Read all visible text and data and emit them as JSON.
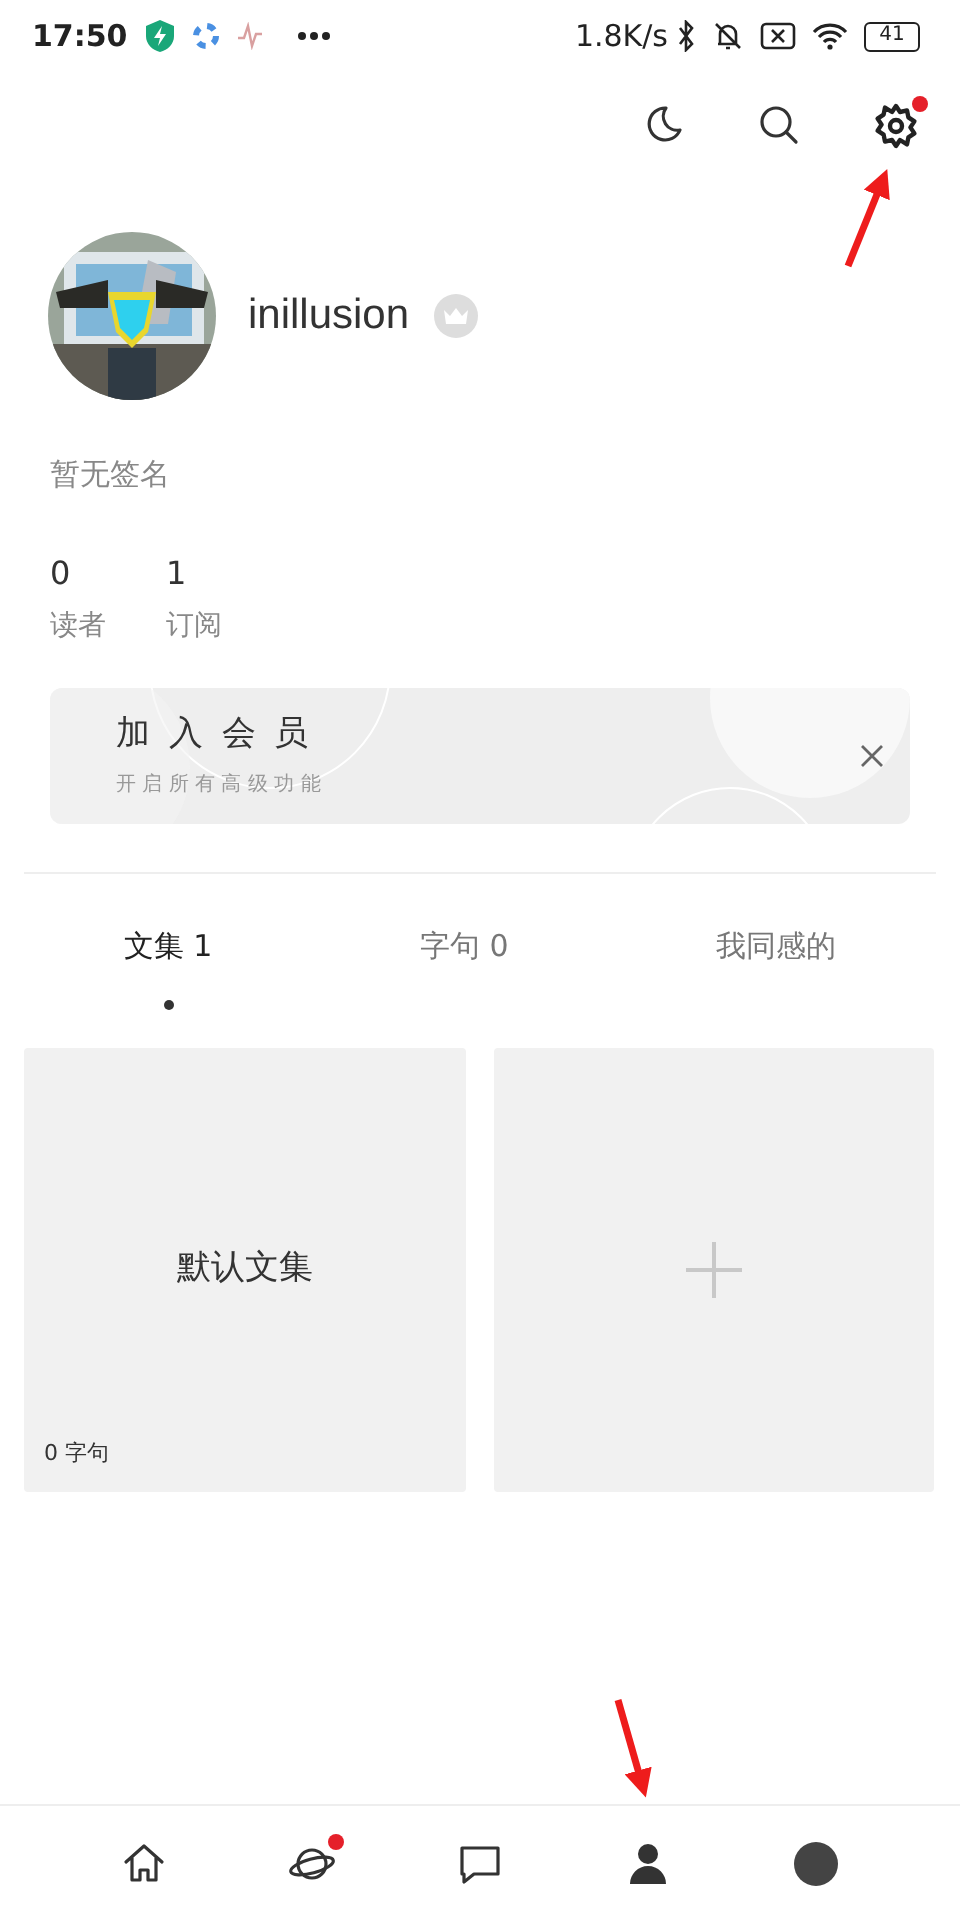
{
  "status_bar": {
    "time": "17:50",
    "net_speed": "1.8K/s",
    "battery": "41"
  },
  "top_actions": [
    {
      "kind": "night",
      "dot": false,
      "annotated": false
    },
    {
      "kind": "search",
      "dot": false,
      "annotated": false
    },
    {
      "kind": "settings",
      "dot": true,
      "annotated": true
    }
  ],
  "profile": {
    "username": "inillusion",
    "signature": "暂无签名",
    "stats": [
      {
        "value": "0",
        "label": "读者"
      },
      {
        "value": "1",
        "label": "订阅"
      }
    ]
  },
  "member_banner": {
    "title": "加 入 会 员",
    "subtitle": "开 启 所 有 高 级 功 能"
  },
  "tabs": [
    {
      "label": "文集 1",
      "selected": true
    },
    {
      "label": "字句 0",
      "selected": false
    },
    {
      "label": "我同感的",
      "selected": false
    }
  ],
  "collections": [
    {
      "kind": "collection",
      "title": "默认文集",
      "count": "0 字句"
    },
    {
      "kind": "add"
    }
  ],
  "bottom_nav": [
    {
      "kind": "home",
      "selected": false,
      "dot": false,
      "annotated": false
    },
    {
      "kind": "discover",
      "selected": false,
      "dot": true,
      "annotated": false
    },
    {
      "kind": "messages",
      "selected": false,
      "dot": false,
      "annotated": false
    },
    {
      "kind": "profile",
      "selected": true,
      "dot": false,
      "annotated": true
    },
    {
      "kind": "write",
      "selected": false,
      "dot": false,
      "annotated": false
    }
  ]
}
